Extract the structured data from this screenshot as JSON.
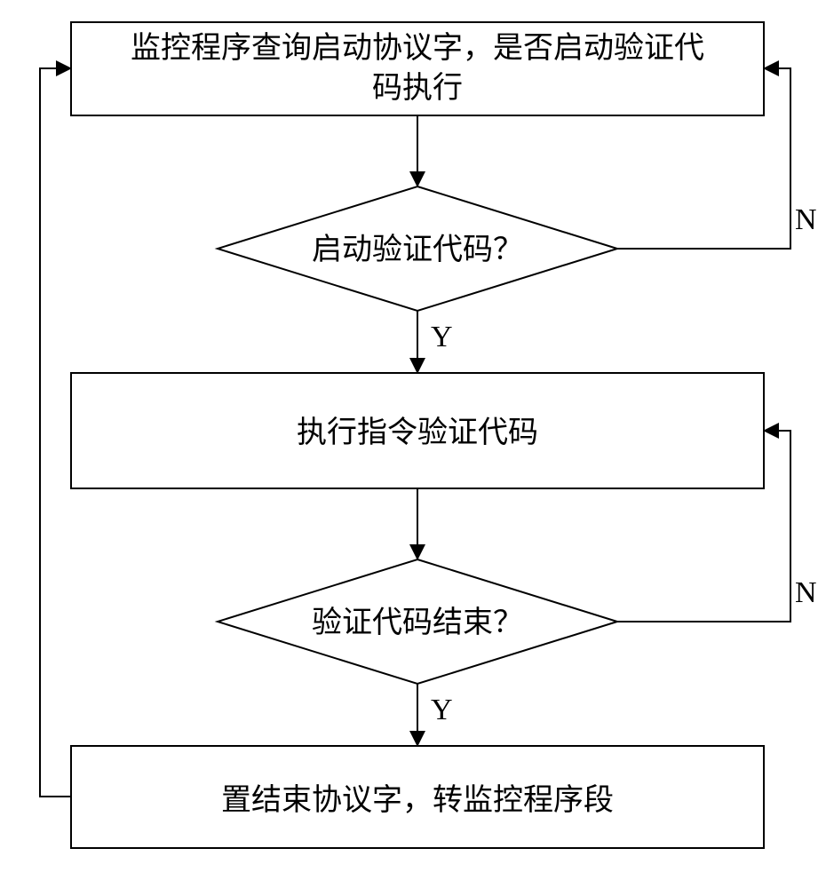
{
  "flow": {
    "step1": {
      "line1": "监控程序查询启动协议字，是否启动验证代",
      "line2": "码执行"
    },
    "decision1": {
      "text": "启动验证代码？",
      "yes": "Y",
      "no": "N"
    },
    "step2": {
      "text": "执行指令验证代码"
    },
    "decision2": {
      "text": "验证代码结束？",
      "yes": "Y",
      "no": "N"
    },
    "step3": {
      "text": "置结束协议字，转监控程序段"
    }
  }
}
